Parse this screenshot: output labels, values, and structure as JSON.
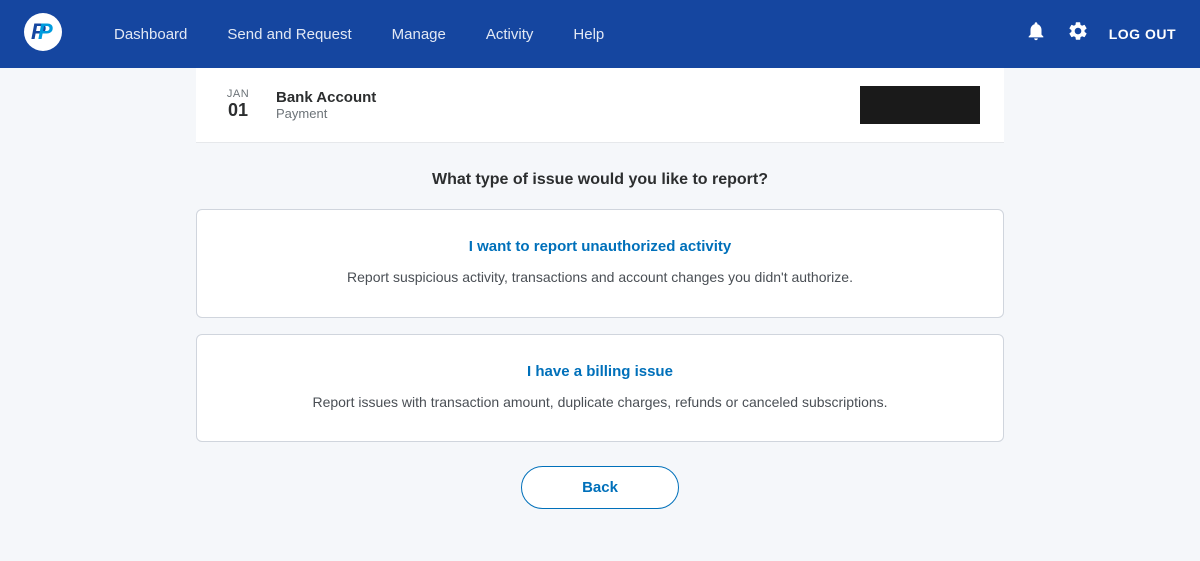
{
  "nav": {
    "logo_symbol": "P",
    "links": [
      {
        "id": "dashboard",
        "label": "Dashboard"
      },
      {
        "id": "send-request",
        "label": "Send and Request"
      },
      {
        "id": "manage",
        "label": "Manage"
      },
      {
        "id": "activity",
        "label": "Activity"
      },
      {
        "id": "help",
        "label": "Help"
      }
    ],
    "logout_label": "LOG OUT"
  },
  "transaction": {
    "month": "JAN",
    "day": "01",
    "title": "Bank Account",
    "subtitle": "Payment"
  },
  "page": {
    "question": "What type of issue would you like to report?"
  },
  "options": [
    {
      "id": "unauthorized",
      "title": "I want to report unauthorized activity",
      "description": "Report suspicious activity, transactions and account changes you didn't authorize."
    },
    {
      "id": "billing",
      "title": "I have a billing issue",
      "description": "Report issues with transaction amount, duplicate charges, refunds or canceled subscriptions."
    }
  ],
  "back_button": {
    "label": "Back"
  }
}
